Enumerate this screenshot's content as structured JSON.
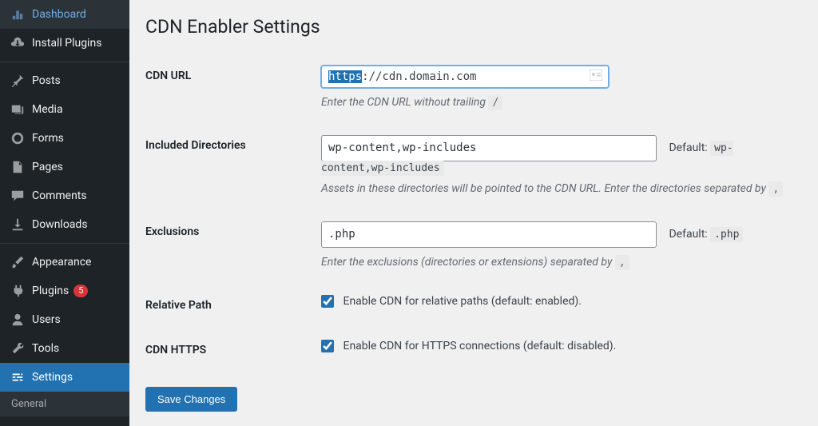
{
  "sidebar": {
    "items": [
      {
        "label": "Dashboard",
        "icon": "dashboard-icon"
      },
      {
        "label": "Install Plugins",
        "icon": "download-icon"
      },
      {
        "label": "Posts",
        "icon": "pin-icon"
      },
      {
        "label": "Media",
        "icon": "media-icon"
      },
      {
        "label": "Forms",
        "icon": "forms-icon"
      },
      {
        "label": "Pages",
        "icon": "page-icon"
      },
      {
        "label": "Comments",
        "icon": "comment-icon"
      },
      {
        "label": "Downloads",
        "icon": "download-icon"
      },
      {
        "label": "Appearance",
        "icon": "brush-icon"
      },
      {
        "label": "Plugins",
        "icon": "plug-icon",
        "badge": "5"
      },
      {
        "label": "Users",
        "icon": "user-icon"
      },
      {
        "label": "Tools",
        "icon": "wrench-icon"
      },
      {
        "label": "Settings",
        "icon": "settings-icon",
        "active": true
      }
    ],
    "submenu": {
      "label": "General"
    }
  },
  "page": {
    "title": "CDN Enabler Settings",
    "cdn_url": {
      "label": "CDN URL",
      "value_sel": "https",
      "value_rest": "://cdn.domain.com",
      "help_pre": "Enter the CDN URL without trailing ",
      "help_code": "/"
    },
    "included": {
      "label": "Included Directories",
      "value": "wp-content,wp-includes",
      "default_label": "Default: ",
      "default_code": "wp-content,wp-includes",
      "help_pre": "Assets in these directories will be pointed to the CDN URL. Enter the directories separated by ",
      "help_code": ","
    },
    "exclusions": {
      "label": "Exclusions",
      "value": ".php",
      "default_label": "Default: ",
      "default_code": ".php",
      "help_pre": "Enter the exclusions (directories or extensions) separated by ",
      "help_code": ","
    },
    "relative": {
      "label": "Relative Path",
      "checkbox_label": "Enable CDN for relative paths (default: enabled).",
      "checked": true
    },
    "https": {
      "label": "CDN HTTPS",
      "checkbox_label": "Enable CDN for HTTPS connections (default: disabled).",
      "checked": true
    },
    "save_button": "Save Changes"
  }
}
